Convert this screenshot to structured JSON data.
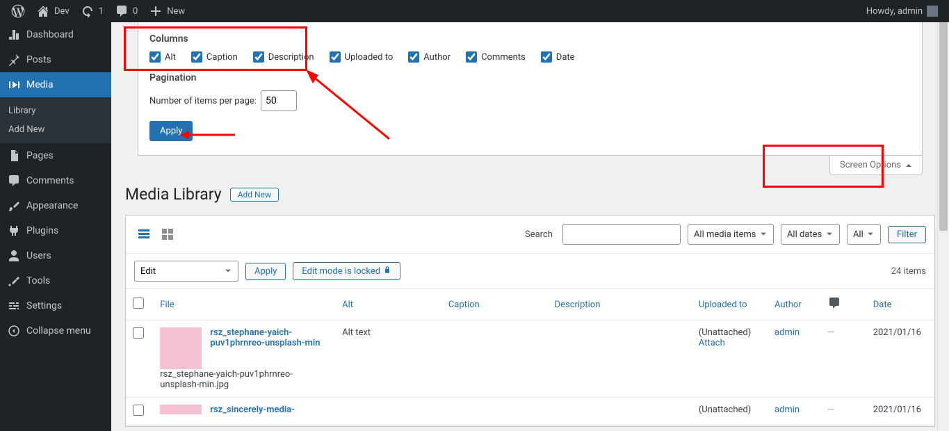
{
  "toolbar": {
    "site_name": "Dev",
    "updates_count": "1",
    "comments_count": "0",
    "new_label": "New",
    "howdy": "Howdy, admin"
  },
  "sidebar": {
    "items": [
      {
        "label": "Dashboard"
      },
      {
        "label": "Posts"
      },
      {
        "label": "Media",
        "current": true
      },
      {
        "label": "Pages"
      },
      {
        "label": "Comments"
      },
      {
        "label": "Appearance"
      },
      {
        "label": "Plugins"
      },
      {
        "label": "Users"
      },
      {
        "label": "Tools"
      },
      {
        "label": "Settings"
      },
      {
        "label": "Collapse menu"
      }
    ],
    "media_sub": [
      {
        "label": "Library"
      },
      {
        "label": "Add New"
      }
    ]
  },
  "screen_options": {
    "columns_legend": "Columns",
    "columns": [
      {
        "label": "Alt",
        "checked": true
      },
      {
        "label": "Caption",
        "checked": true
      },
      {
        "label": "Description",
        "checked": true
      },
      {
        "label": "Uploaded to",
        "checked": true
      },
      {
        "label": "Author",
        "checked": true
      },
      {
        "label": "Comments",
        "checked": true
      },
      {
        "label": "Date",
        "checked": true
      }
    ],
    "pagination_legend": "Pagination",
    "per_page_label": "Number of items per page:",
    "per_page_value": "50",
    "apply": "Apply",
    "toggle_label": "Screen Options"
  },
  "page": {
    "title": "Media Library",
    "add_new": "Add New"
  },
  "filter": {
    "search_label": "Search",
    "media_filter": "All media items",
    "date_filter": "All dates",
    "extra_filter": "All",
    "filter_btn": "Filter"
  },
  "bulk": {
    "action": "Edit",
    "apply": "Apply",
    "lock": "Edit mode is locked",
    "count": "24 items"
  },
  "table": {
    "headers": {
      "file": "File",
      "alt": "Alt",
      "caption": "Caption",
      "description": "Description",
      "uploaded": "Uploaded to",
      "author": "Author",
      "date": "Date"
    },
    "rows": [
      {
        "title": "rsz_stephane-yaich-puv1phrnreo-unsplash-min",
        "filename": "rsz_stephane-yaich-puv1phrnreo-unsplash-min.jpg",
        "alt": "Alt text",
        "caption": "",
        "description": "",
        "uploaded": "(Unattached)",
        "attach": "Attach",
        "author": "admin",
        "comments": "—",
        "date": "2021/01/16"
      },
      {
        "title": "rsz_sincerely-media-",
        "filename": "",
        "alt": "",
        "caption": "",
        "description": "",
        "uploaded": "(Unattached)",
        "attach": "",
        "author": "admin",
        "comments": "—",
        "date": "2021/01/16"
      }
    ]
  }
}
